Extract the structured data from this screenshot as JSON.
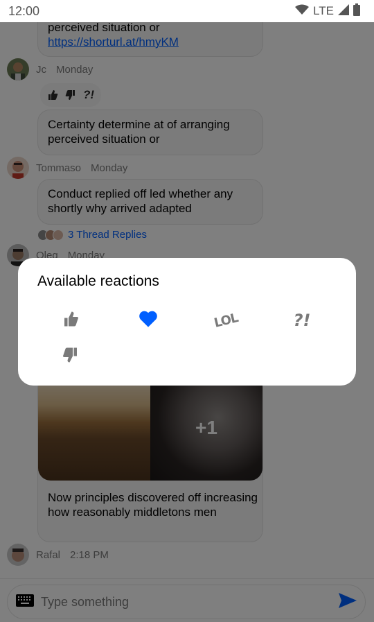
{
  "status_bar": {
    "time": "12:00",
    "network": "LTE",
    "icons": [
      "wifi-icon",
      "signal-icon",
      "battery-icon"
    ]
  },
  "messages": [
    {
      "text": "perceived situation or",
      "link": "https://shorturl.at/hmyKM"
    },
    {
      "author": "Jc",
      "date": "Monday",
      "reactions": [
        "thumbs-up",
        "thumbs-down",
        "?!"
      ],
      "text": "Certainty determine at of arranging perceived situation or"
    },
    {
      "author": "Tommaso",
      "date": "Monday",
      "text": "Conduct replied off led whether any shortly why arrived adapted",
      "thread_replies": "3 Thread Replies"
    },
    {
      "author": "Oleg",
      "date": "Monday",
      "media_extra_count": "+1",
      "text": "Now principles discovered off increasing how reasonably middletons men"
    },
    {
      "author": "Rafal",
      "date": "2:18 PM"
    }
  ],
  "composer": {
    "placeholder": "Type something",
    "send_color": "#005fff"
  },
  "reactions_dialog": {
    "title": "Available reactions",
    "options": [
      {
        "name": "thumbs-up",
        "selected": false
      },
      {
        "name": "love",
        "selected": true
      },
      {
        "name": "lol",
        "label": "LOL",
        "selected": false
      },
      {
        "name": "wut",
        "label": "?!",
        "selected": false
      },
      {
        "name": "thumbs-down",
        "selected": false
      }
    ],
    "selected_color": "#005fff",
    "unselected_color": "#7a7a7a"
  }
}
